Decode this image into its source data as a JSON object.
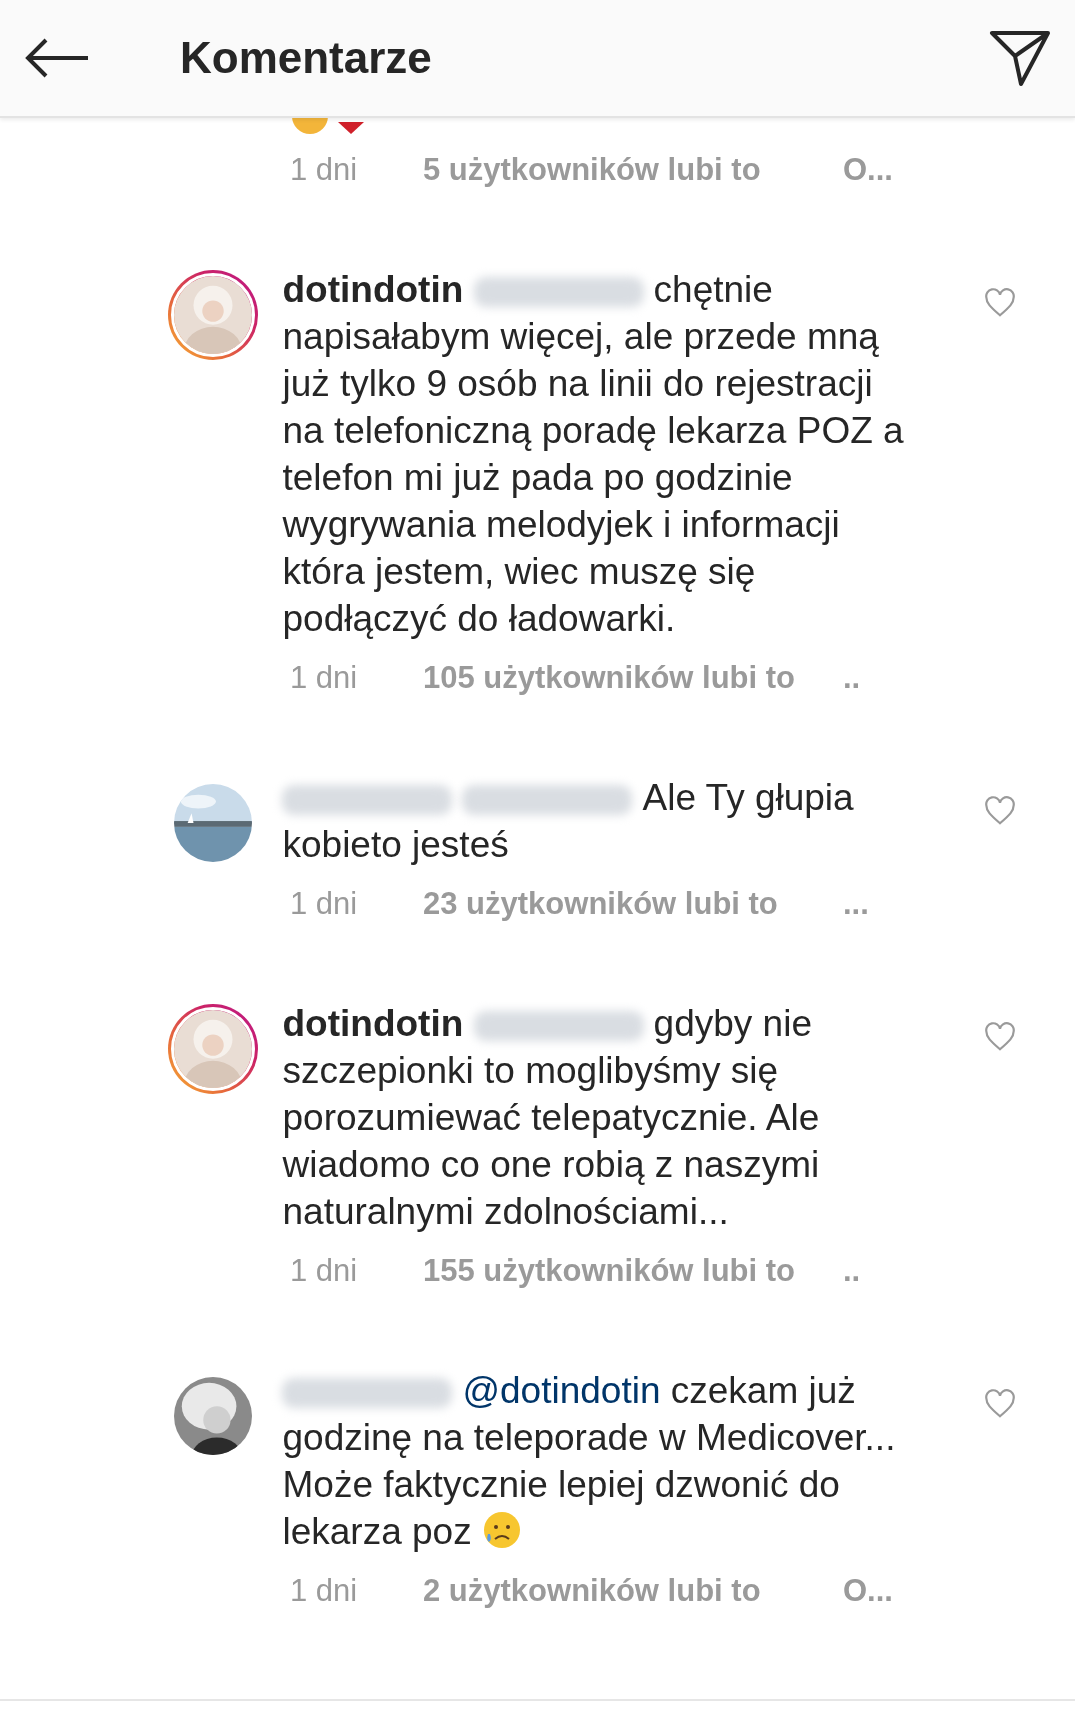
{
  "header": {
    "title": "Komentarze"
  },
  "partial_comment": {
    "time": "1 dni",
    "likes": "5 użytkowników lubi to",
    "reply": "O..."
  },
  "comments": [
    {
      "story_ring": true,
      "parts": [
        {
          "kind": "author",
          "text": "dotindotin"
        },
        {
          "kind": "blurred"
        },
        {
          "kind": "text",
          "text": "chętnie napisałabym więcej, ale przede mną już tylko 9 osób na linii do rejestracji na telefoniczną poradę lekarza POZ a telefon mi już pada po  godzinie wygrywania melodyjek i informacji która jestem, wiec muszę się podłączyć do ładowarki."
        }
      ],
      "time": "1 dni",
      "likes": "105 użytkowników lubi to",
      "reply": ".."
    },
    {
      "story_ring": false,
      "parts": [
        {
          "kind": "blurred"
        },
        {
          "kind": "blurred"
        },
        {
          "kind": "text",
          "text": "Ale Ty głupia kobieto jesteś"
        }
      ],
      "time": "1 dni",
      "likes": "23 użytkowników lubi to",
      "reply": "..."
    },
    {
      "story_ring": true,
      "parts": [
        {
          "kind": "author",
          "text": "dotindotin"
        },
        {
          "kind": "blurred"
        },
        {
          "kind": "text",
          "text": "gdyby nie szczepionki to moglibyśmy się porozumiewać telepatycznie. Ale wiadomo co one robią z naszymi naturalnymi zdolnościami..."
        }
      ],
      "time": "1 dni",
      "likes": "155 użytkowników lubi to",
      "reply": ".."
    },
    {
      "story_ring": false,
      "parts": [
        {
          "kind": "blurred"
        },
        {
          "kind": "mention",
          "text": "@dotindotin"
        },
        {
          "kind": "text",
          "text": "czekam już godzinę na teleporade w Medicover... Może faktycznie lepiej dzwonić do lekarza poz"
        },
        {
          "kind": "emoji"
        }
      ],
      "time": "1 dni",
      "likes": "2 użytkowników lubi to",
      "reply": "O..."
    }
  ]
}
